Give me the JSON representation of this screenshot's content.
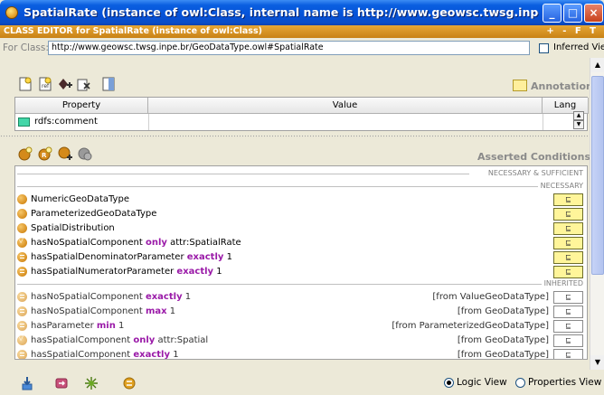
{
  "window": {
    "title": "SpatialRate   (instance of owl:Class, internal name is http://www.geowsc.twsg.inpe.br/GeoD...",
    "minimize": "_",
    "maximize": "□",
    "close": "×"
  },
  "editor": {
    "title": "CLASS EDITOR for SpatialRate   (instance of owl:Class)",
    "controls": "+ - F T"
  },
  "for_class": {
    "label": "For Class:",
    "value": "http://www.geowsc.twsg.inpe.br/GeoDataType.owl#SpatialRate",
    "inferred_label": "Inferred View"
  },
  "annotations": {
    "label": "Annotations",
    "columns": [
      "Property",
      "Value",
      "Lang"
    ],
    "rows": [
      {
        "property": "rdfs:comment",
        "value": "",
        "lang": ""
      }
    ]
  },
  "conditions": {
    "label": "Asserted Conditions",
    "sections": {
      "nec_suf": "NECESSARY & SUFFICIENT",
      "nec": "NECESSARY",
      "inh": "INHERITED"
    },
    "necessary": [
      {
        "name": "NumericGeoDataType",
        "kw": "",
        "rest": ""
      },
      {
        "name": "ParameterizedGeoDataType",
        "kw": "",
        "rest": ""
      },
      {
        "name": "SpatialDistribution",
        "kw": "",
        "rest": ""
      },
      {
        "name": "hasNoSpatialComponent",
        "kw": "only",
        "rest": "attr:SpatialRate"
      },
      {
        "name": "hasSpatialDenominatorParameter",
        "kw": "exactly",
        "rest": "1"
      },
      {
        "name": "hasSpatialNumeratorParameter",
        "kw": "exactly",
        "rest": "1"
      }
    ],
    "inherited": [
      {
        "name": "hasNoSpatialComponent",
        "kw": "exactly",
        "rest": "1",
        "from": "[from ValueGeoDataType]"
      },
      {
        "name": "hasNoSpatialComponent",
        "kw": "max",
        "rest": "1",
        "from": "[from GeoDataType]"
      },
      {
        "name": "hasParameter",
        "kw": "min",
        "rest": "1",
        "from": "[from ParameterizedGeoDataType]"
      },
      {
        "name": "hasSpatialComponent",
        "kw": "only",
        "rest": "attr:Spatial",
        "from": "[from GeoDataType]"
      },
      {
        "name": "hasSpatialComponent",
        "kw": "exactly",
        "rest": "1",
        "from": "[from GeoDataType]"
      }
    ],
    "badge": "⊑"
  },
  "view": {
    "logic": "Logic View",
    "properties": "Properties View",
    "selected": "logic"
  },
  "colors": {
    "title_bar": "#0552d8",
    "editor_bar": "#d99224",
    "keyword": "#9a1aa8",
    "badge_yellow": "#fff59a"
  }
}
